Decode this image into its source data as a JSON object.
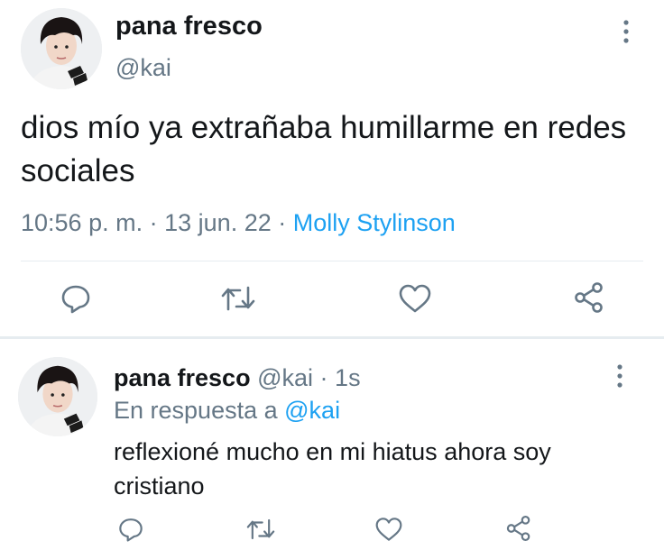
{
  "tweet": {
    "display_name": "pana fresco",
    "handle": "@kai",
    "text": "dios mío ya extrañaba humillarme en redes sociales",
    "time": "10:56 p. m.",
    "date": "13 jun. 22",
    "separator": "·",
    "source": "Molly Stylinson",
    "icons": [
      "more-icon",
      "reply-icon",
      "retweet-icon",
      "like-icon",
      "share-icon"
    ]
  },
  "reply": {
    "display_name": "pana fresco",
    "handle": "@kai",
    "separator": "·",
    "age": "1s",
    "replying_to_label": "En respuesta a",
    "replying_to_handle": "@kai",
    "text": "reflexioné mucho en mi hiatus ahora soy cristiano",
    "icons": [
      "more-icon",
      "reply-icon",
      "retweet-icon",
      "like-icon",
      "share-icon"
    ]
  },
  "colors": {
    "text": "#14171a",
    "secondary": "#657786",
    "link": "#1da1f2",
    "divider": "#e6ecf0"
  }
}
